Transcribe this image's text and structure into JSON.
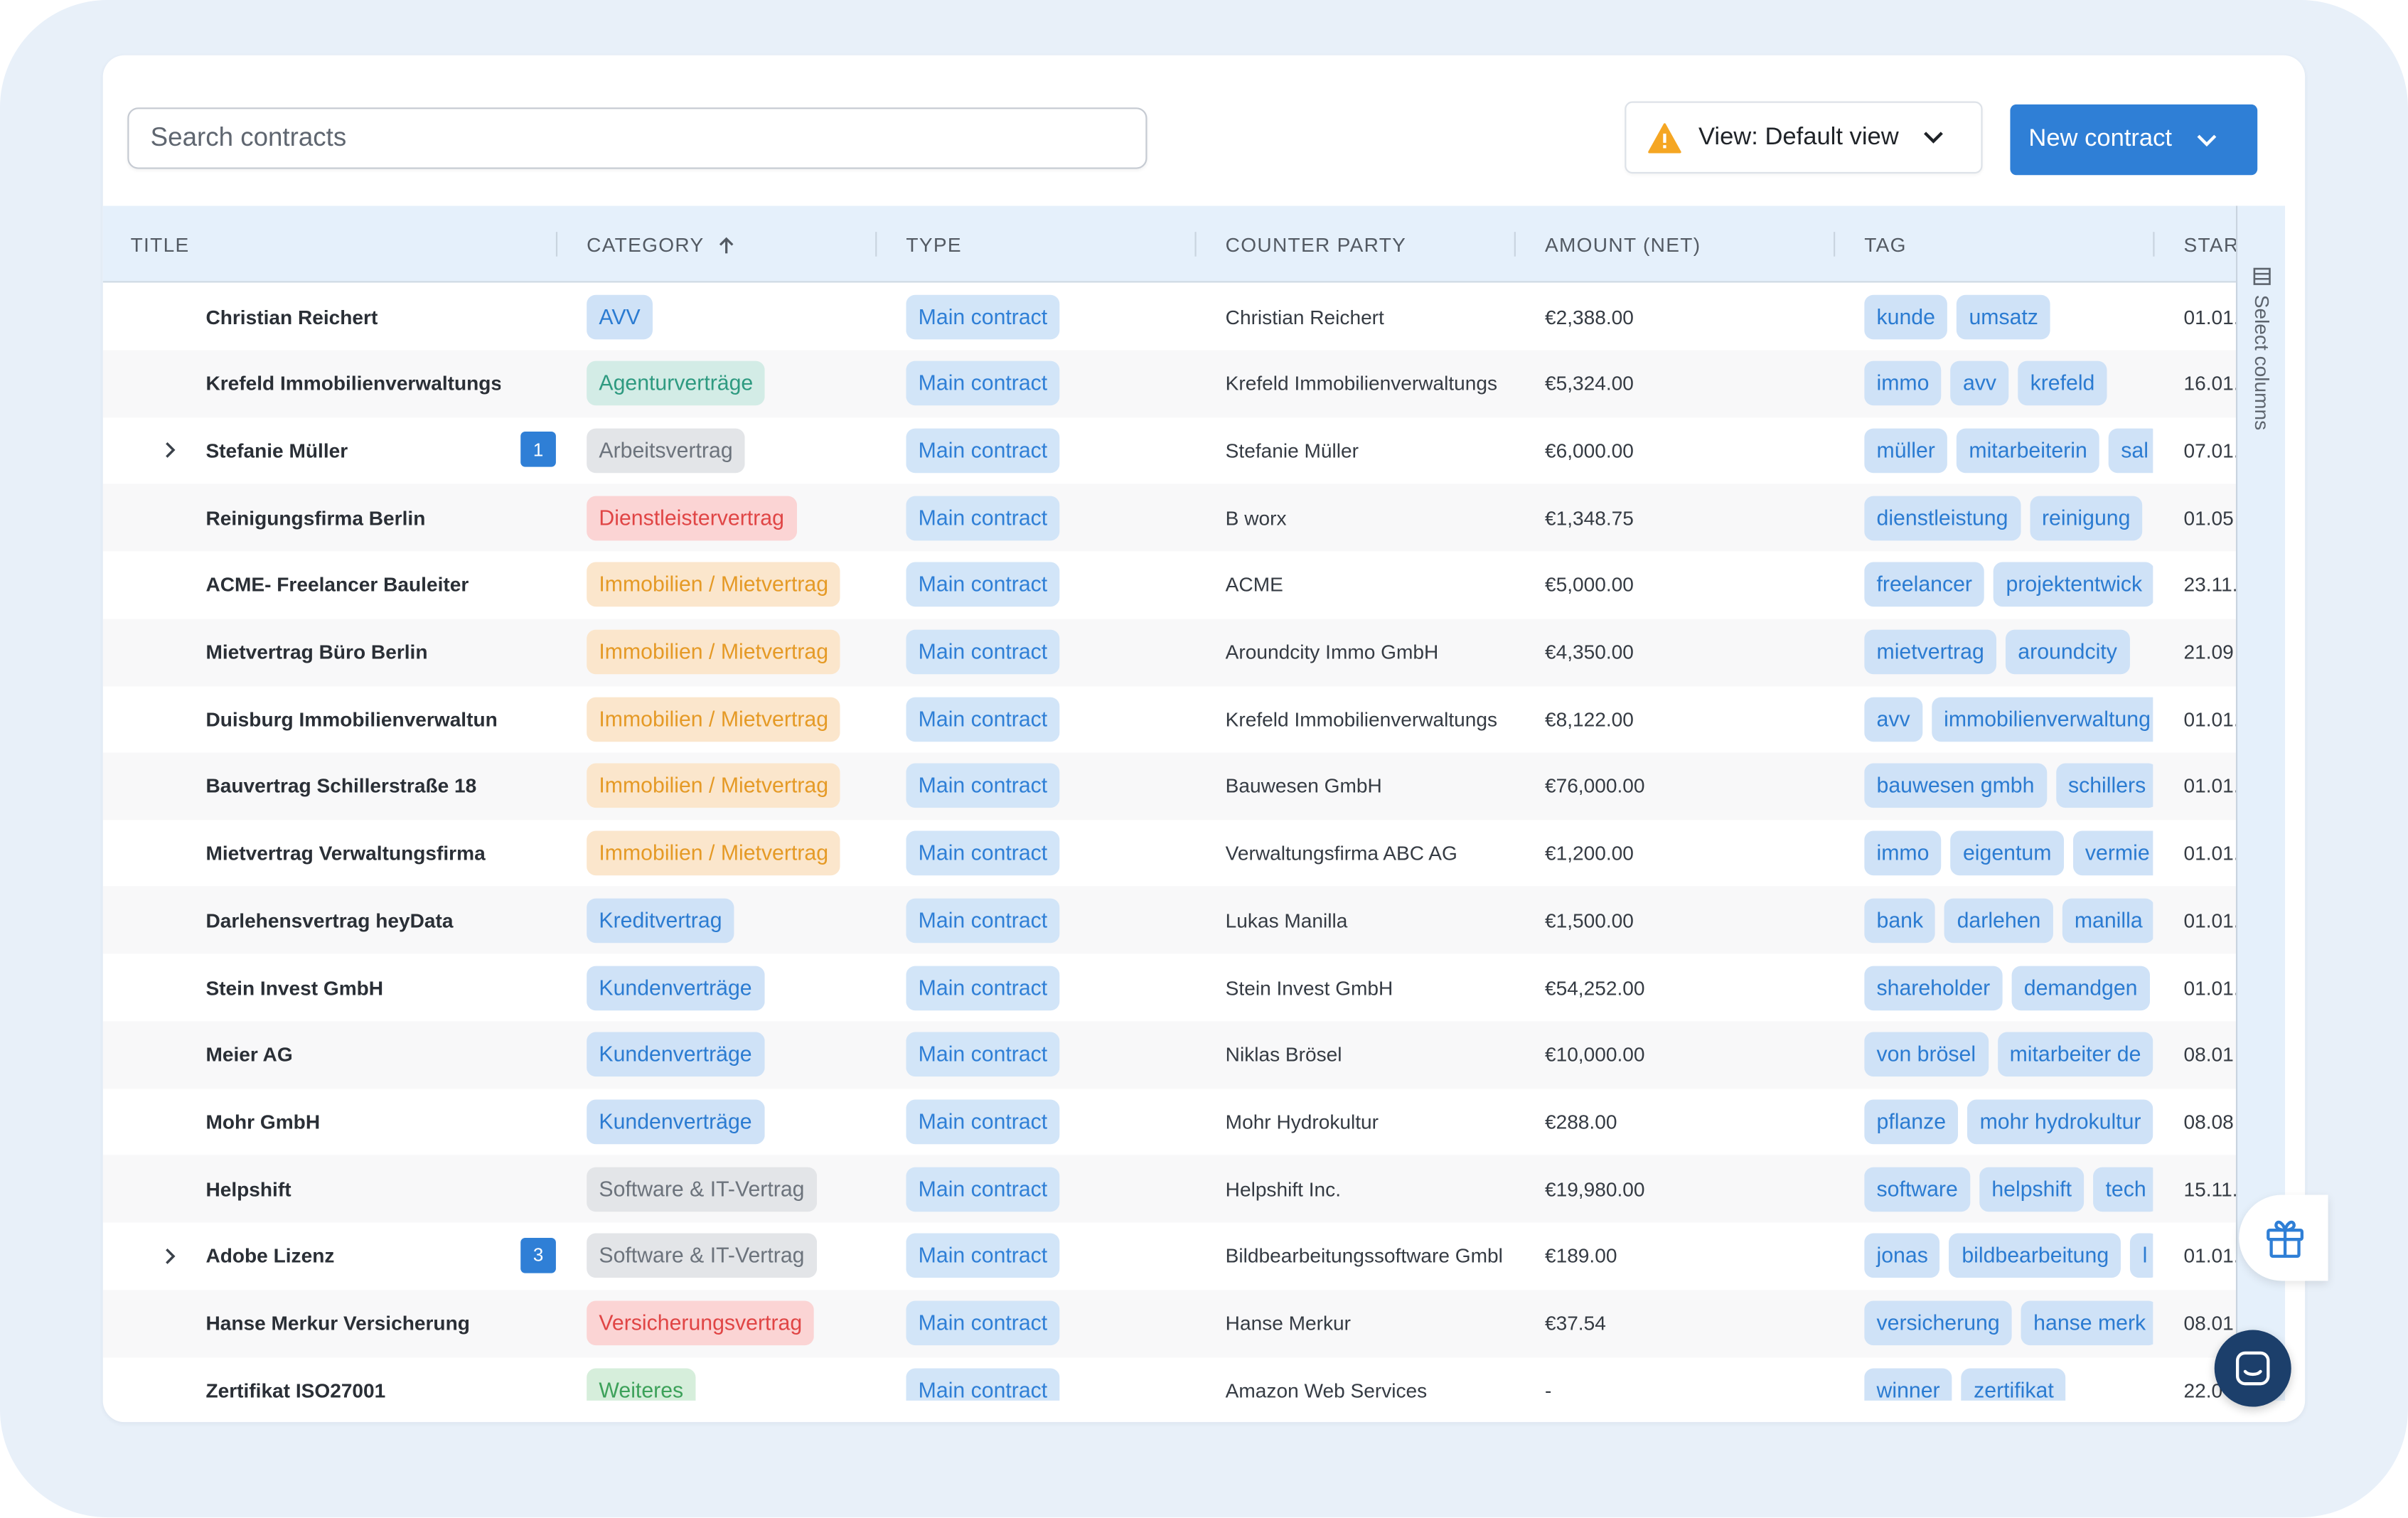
{
  "search": {
    "placeholder": "Search contracts"
  },
  "view_button": {
    "label": "View: Default view"
  },
  "new_button": {
    "label": "New contract"
  },
  "columns": {
    "title": "TITLE",
    "category": "CATEGORY",
    "type": "TYPE",
    "counter_party": "COUNTER PARTY",
    "amount": "AMOUNT (NET)",
    "tag": "TAG",
    "start": "STAR"
  },
  "sidebar": {
    "select_columns": "Select columns"
  },
  "colors": {
    "accent": "#2f7fd6",
    "header_bg": "#e5f0fb",
    "warning": "#f5a623",
    "chat": "#1c3f6b"
  },
  "rows": [
    {
      "title": "Christian Reichert",
      "category": "AVV",
      "cat_color": "blue",
      "type": "Main contract",
      "counter_party": "Christian Reichert",
      "amount": "€2,388.00",
      "tags": [
        "kunde",
        "umsatz"
      ],
      "start": "01.01."
    },
    {
      "title": "Krefeld Immobilienverwaltungs",
      "category": "Agenturverträge",
      "cat_color": "teal",
      "type": "Main contract",
      "counter_party": "Krefeld Immobilienverwaltungs",
      "amount": "€5,324.00",
      "tags": [
        "immo",
        "avv",
        "krefeld"
      ],
      "start": "16.01."
    },
    {
      "title": "Stefanie Müller",
      "expandable": true,
      "count": "1",
      "category": "Arbeitsvertrag",
      "cat_color": "gray",
      "type": "Main contract",
      "counter_party": "Stefanie Müller",
      "amount": "€6,000.00",
      "tags": [
        "müller",
        "mitarbeiterin",
        "sal"
      ],
      "start": "07.01."
    },
    {
      "title": "Reinigungsfirma Berlin",
      "category": "Dienstleistervertrag",
      "cat_color": "red",
      "type": "Main contract",
      "counter_party": "B worx",
      "amount": "€1,348.75",
      "tags": [
        "dienstleistung",
        "reinigung"
      ],
      "start": "01.05"
    },
    {
      "title": "ACME- Freelancer Bauleiter",
      "category": "Immobilien / Mietvertrag",
      "cat_color": "orange",
      "type": "Main contract",
      "counter_party": "ACME",
      "amount": "€5,000.00",
      "tags": [
        "freelancer",
        "projektentwick"
      ],
      "start": "23.11."
    },
    {
      "title": "Mietvertrag Büro Berlin",
      "category": "Immobilien / Mietvertrag",
      "cat_color": "orange",
      "type": "Main contract",
      "counter_party": "Aroundcity Immo GmbH",
      "amount": "€4,350.00",
      "tags": [
        "mietvertrag",
        "aroundcity"
      ],
      "start": "21.09"
    },
    {
      "title": "Duisburg Immobilienverwaltun",
      "category": "Immobilien / Mietvertrag",
      "cat_color": "orange",
      "type": "Main contract",
      "counter_party": "Krefeld Immobilienverwaltungs",
      "amount": "€8,122.00",
      "tags": [
        "avv",
        "immobilienverwaltung"
      ],
      "start": "01.01."
    },
    {
      "title": "Bauvertrag Schillerstraße 18",
      "category": "Immobilien / Mietvertrag",
      "cat_color": "orange",
      "type": "Main contract",
      "counter_party": "Bauwesen GmbH",
      "amount": "€76,000.00",
      "tags": [
        "bauwesen gmbh",
        "schillers"
      ],
      "start": "01.01."
    },
    {
      "title": "Mietvertrag Verwaltungsfirma",
      "category": "Immobilien / Mietvertrag",
      "cat_color": "orange",
      "type": "Main contract",
      "counter_party": "Verwaltungsfirma ABC AG",
      "amount": "€1,200.00",
      "tags": [
        "immo",
        "eigentum",
        "vermie"
      ],
      "start": "01.01."
    },
    {
      "title": "Darlehensvertrag heyData",
      "category": "Kreditvertrag",
      "cat_color": "blue",
      "type": "Main contract",
      "counter_party": "Lukas Manilla",
      "amount": "€1,500.00",
      "tags": [
        "bank",
        "darlehen",
        "manilla"
      ],
      "start": "01.01."
    },
    {
      "title": "Stein Invest GmbH",
      "category": "Kundenverträge",
      "cat_color": "blue",
      "type": "Main contract",
      "counter_party": "Stein Invest GmbH",
      "amount": "€54,252.00",
      "tags": [
        "shareholder",
        "demandgen"
      ],
      "start": "01.01."
    },
    {
      "title": "Meier AG",
      "category": "Kundenverträge",
      "cat_color": "blue",
      "type": "Main contract",
      "counter_party": "Niklas Brösel",
      "amount": "€10,000.00",
      "tags": [
        "von brösel",
        "mitarbeiter de"
      ],
      "start": "08.01"
    },
    {
      "title": "Mohr GmbH",
      "category": "Kundenverträge",
      "cat_color": "blue",
      "type": "Main contract",
      "counter_party": "Mohr Hydrokultur",
      "amount": "€288.00",
      "tags": [
        "pflanze",
        "mohr hydrokultur"
      ],
      "start": "08.08"
    },
    {
      "title": "Helpshift",
      "category": "Software & IT-Vertrag",
      "cat_color": "gray",
      "type": "Main contract",
      "counter_party": "Helpshift Inc.",
      "amount": "€19,980.00",
      "tags": [
        "software",
        "helpshift",
        "tech"
      ],
      "start": "15.11."
    },
    {
      "title": "Adobe Lizenz",
      "expandable": true,
      "count": "3",
      "category": "Software & IT-Vertrag",
      "cat_color": "gray",
      "type": "Main contract",
      "counter_party": "Bildbearbeitungssoftware Gmbl",
      "amount": "€189.00",
      "tags": [
        "jonas",
        "bildbearbeitung",
        "l"
      ],
      "start": "01.01."
    },
    {
      "title": "Hanse Merkur Versicherung",
      "category": "Versicherungsvertrag",
      "cat_color": "red",
      "type": "Main contract",
      "counter_party": "Hanse Merkur",
      "amount": "€37.54",
      "tags": [
        "versicherung",
        "hanse merk"
      ],
      "start": "08.01"
    },
    {
      "title": "Zertifikat ISO27001",
      "category": "Weiteres",
      "cat_color": "green",
      "type": "Main contract",
      "counter_party": "Amazon Web Services",
      "amount": "-",
      "tags": [
        "winner",
        "zertifikat"
      ],
      "start": "22.0"
    }
  ]
}
